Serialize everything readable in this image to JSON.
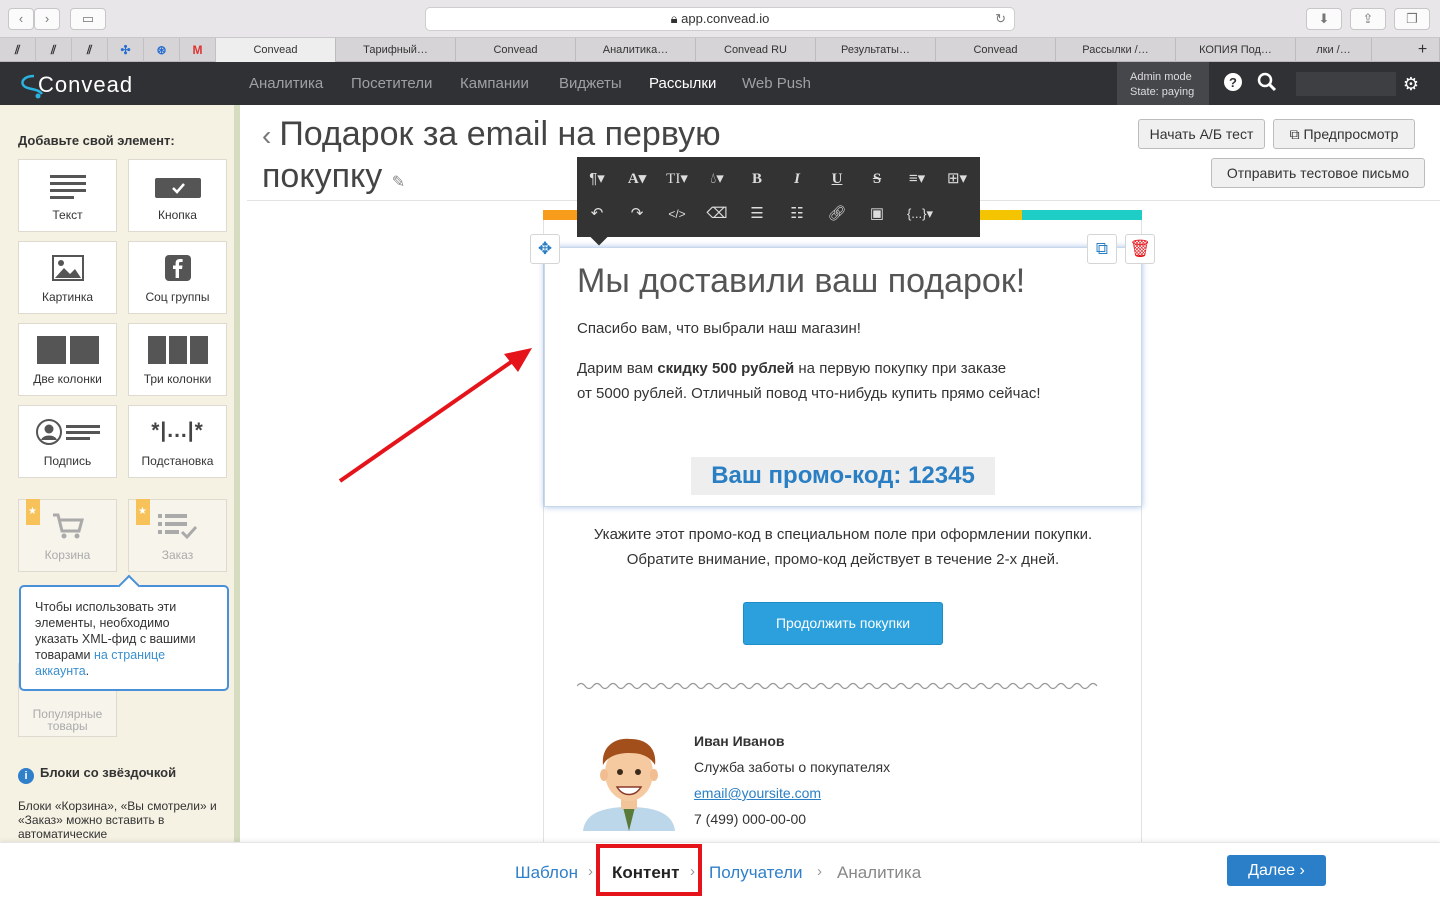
{
  "browser": {
    "url": "app.convead.io",
    "tabs": [
      "Convead",
      "Тарифный…",
      "Convead",
      "Аналитика…",
      "Convead RU",
      "Результаты…",
      "Convead",
      "Рассылки /…",
      "КОПИЯ Под…",
      "лки /…"
    ]
  },
  "header": {
    "logo": "Convead",
    "nav": [
      "Аналитика",
      "Посетители",
      "Кампании",
      "Виджеты",
      "Рассылки",
      "Web Push"
    ],
    "active_nav": "Рассылки",
    "admin_mode": "Admin mode",
    "admin_state": "State: paying"
  },
  "sidebar": {
    "title": "Добавьте свой элемент:",
    "tiles": [
      {
        "label": "Текст",
        "icon": "text-icon"
      },
      {
        "label": "Кнопка",
        "icon": "button-icon"
      },
      {
        "label": "Картинка",
        "icon": "image-icon"
      },
      {
        "label": "Соц группы",
        "icon": "facebook-icon"
      },
      {
        "label": "Две колонки",
        "icon": "two-columns-icon"
      },
      {
        "label": "Три колонки",
        "icon": "three-columns-icon"
      },
      {
        "label": "Подпись",
        "icon": "signature-icon"
      },
      {
        "label": "Подстановка",
        "icon": "substitution-icon",
        "glyph": "*|...|*"
      },
      {
        "label": "Корзина",
        "icon": "cart-icon"
      },
      {
        "label": "Заказ",
        "icon": "order-icon"
      },
      {
        "label": "Популярные товары",
        "icon": "popular-icon"
      }
    ],
    "tooltip_text": "Чтобы использовать эти элементы, необходимо указать XML-фид с вашими товарами ",
    "tooltip_link": "на странице аккаунта",
    "tooltip_end": ".",
    "info_title": "Блоки со звёздочкой",
    "info_text": "Блоки «Корзина», «Вы смотрели» и «Заказ» можно вставить в автоматические"
  },
  "main": {
    "title_line1": "Подарок за email на первую",
    "title_line2": "покупку",
    "ab_test_button": "Начать А/Б тест",
    "preview_button": "Предпросмотр",
    "test_email_button": "Отправить тестовое письмо"
  },
  "email": {
    "stripe_colors": [
      "#f89c1c",
      "#f89c1c",
      "#f89c1c",
      "#f89c1c",
      "#f5c400",
      "#1ecdc5"
    ],
    "heading": "Мы доставили ваш подарок!",
    "thanks": "Спасибо вам, что выбрали наш магазин!",
    "gift_pre": "Дарим вам ",
    "gift_bold": "скидку 500 рублей",
    "gift_post": " на первую покупку при заказе",
    "gift_line2": "от 5000 рублей. Отличный повод что-нибудь купить прямо сейчас!",
    "promo": "Ваш промо-код: 12345",
    "instr_line1": "Укажите этот промо-код в специальном поле при оформлении покупки.",
    "instr_line2": "Обратите внимание, промо-код действует в течение 2-х дней.",
    "cta": "Продолжить покупки",
    "sig_name": "Иван Иванов",
    "sig_role": "Служба заботы о покупателях",
    "sig_email": "email@yoursite.com",
    "sig_phone": "7 (499) 000-00-00"
  },
  "steps": {
    "items": [
      "Шаблон",
      "Контент",
      "Получатели",
      "Аналитика"
    ],
    "current": "Контент",
    "next": "Далее ›"
  },
  "colors": {
    "accent": "#2b7fc9",
    "highlight_red": "#e5141b",
    "header_bg": "#303134"
  }
}
